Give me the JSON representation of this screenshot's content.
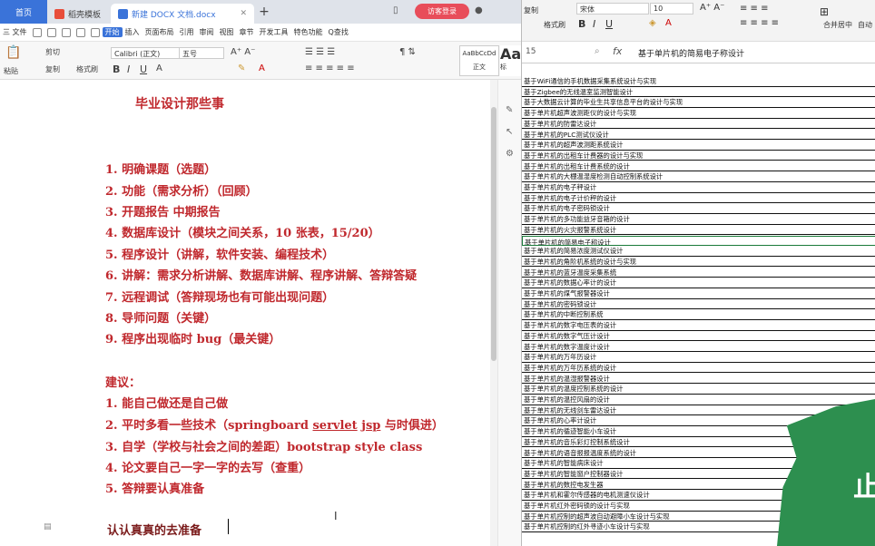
{
  "tabs": {
    "home": "首页",
    "template": "稻壳模板",
    "doc": "新建 DOCX 文档.docx"
  },
  "login": "访客登录",
  "menu": [
    "三 文件",
    "开始",
    "插入",
    "页面布局",
    "引用",
    "审阅",
    "视图",
    "章节",
    "开发工具",
    "特色功能",
    "Q查找"
  ],
  "ribbon": {
    "paste": "粘贴",
    "cut": "剪切",
    "copy": "复制",
    "format_painter": "格式刷",
    "font": "Calibri (正文)",
    "size": "五号",
    "style_preview": "AaBbCcDd",
    "style_name": "正文",
    "style2": "Aa",
    "style2_label": "标"
  },
  "doc": {
    "title": "毕业设计那些事",
    "steps": [
      "1.  明确课题（选题）",
      "2.  功能（需求分析）（回顾）",
      "3.  开题报告  中期报告",
      "4.  数据库设计（模块之间关系，10 张表，15/20）",
      "5.  程序设计（讲解，软件安装、编程技术）",
      "6.  讲解：需求分析讲解、数据库讲解、程序讲解、答辩答疑",
      "7.  远程调试（答辩现场也有可能出现问题）",
      "8.  导师问题（关键）",
      "9.  程序出现临时 bug（最关键）"
    ],
    "suggestion_heading": "建议：",
    "s1": "1.  能自己做还是自己做",
    "s2_pre": "2.  平时多看一些技术（springboard ",
    "s2_servlet": "servlet",
    "s2_space": " ",
    "s2_jsp": "jsp",
    "s2_post": "  与时俱进）",
    "s3": "3.  自学（学校与社会之间的差距）bootstrap style class",
    "s4": "4.  论文要自己一字一字的去写（查重）",
    "s5": "5.  答辩要认真准备",
    "closing": "认认真真的去准备"
  },
  "sheet": {
    "toolbar": {
      "copy": "复制",
      "format_painter": "格式刷",
      "font": "宋体",
      "size": "10",
      "merge": "合并居中",
      "wrap": "自动"
    },
    "cell_ref": "15",
    "fx": "fx",
    "formula": "基于单片机的简易电子称设计",
    "rows": [
      "基于WiFi通信的手机数据采集系统设计与实现",
      "基于Zigbee的无线温室监测智能设计",
      "基于大数据云计算的毕业生共享信息平台的设计与实现",
      "基于单片机超声波测距仪的设计与实现",
      "基于单片机的防雷达设计",
      "基于单片机的PLC测试仪设计",
      "基于单片机的超声波测距系统设计",
      "基于单片机的出租车计费器的设计与实现",
      "基于单片机的出租车计费系统的设计",
      "基于单片机的大棚温湿度检测自动控制系统设计",
      "基于单片机的电子秤设计",
      "基于单片机的电子计价秤的设计",
      "基于单片机的电子密码锁设计",
      "基于单片机的多功能益牙音箱的设计",
      "基于单片机的火灾报警系统设计",
      "基于单片机的简易电子称设计",
      "基于单片机的简易浓度测试仪设计",
      "基于单片机的角阶机系统的设计与实现",
      "基于单片机的蓝牙温度采集系统",
      "基于单片机的数据心率计的设计",
      "基于单片机的煤气报警器设计",
      "基于单片机的密码锁设计",
      "基于单片机的中断控制系统",
      "基于单片机的数字电压表的设计",
      "基于单片机的数字气压计设计",
      "基于单片机的数字温度计设计",
      "基于单片机的万年历设计",
      "基于单片机的万年历系统的设计",
      "基于单片机的温湿报警器设计",
      "基于单片机的温度控制系统的设计",
      "基于单片机的温控风扇的设计",
      "基于单片机的无线剑车雷达设计",
      "基于单片机的心率计设计",
      "基于单片机的循迹智能小车设计",
      "基于单片机的音乐彩灯控制系统设计",
      "基于单片机的语音报报温度系统的设计",
      "基于单片机的智能病床设计",
      "基于单片机的智能窗户控制器设计",
      "基于单片机的数控电发生器",
      "基于单片机和霍尔传感器的电机测速仪设计",
      "基于单片机红外密码锁的设计与实现",
      "基于单片机控制的超声波自动避障小车设计与实现",
      "基于单片机控制的红外寻迹小车设计与实现"
    ]
  }
}
